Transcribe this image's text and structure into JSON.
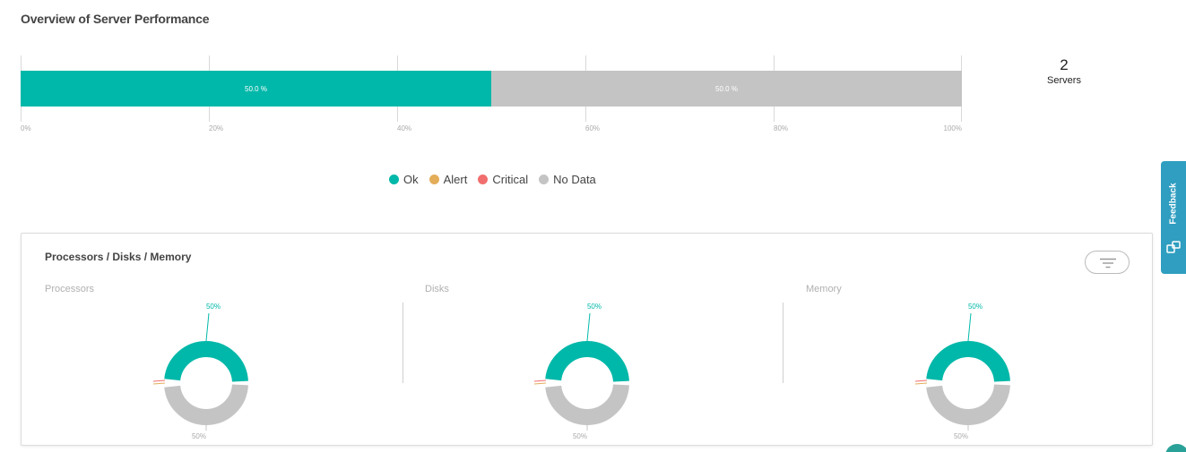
{
  "page": {
    "title": "Overview of Server Performance"
  },
  "colors": {
    "ok": "#00b8a9",
    "alert": "#e4ad5a",
    "critical": "#f16e6e",
    "no_data": "#c4c4c4",
    "feedback": "#2f9ec0"
  },
  "overview": {
    "ticks": [
      "0%",
      "20%",
      "40%",
      "60%",
      "80%",
      "100%"
    ],
    "segments": [
      {
        "status": "ok",
        "value": 50.0,
        "label": "50.0 %"
      },
      {
        "status": "no_data",
        "value": 50.0,
        "label": "50.0 %"
      }
    ],
    "server_count": "2",
    "server_label": "Servers"
  },
  "legend": [
    {
      "label": "Ok",
      "color": "#00b8a9"
    },
    {
      "label": "Alert",
      "color": "#e4ad5a"
    },
    {
      "label": "Critical",
      "color": "#f16e6e"
    },
    {
      "label": "No Data",
      "color": "#c4c4c4"
    }
  ],
  "card": {
    "title": "Processors / Disks / Memory",
    "filter_icon": "filter-icon",
    "panels": [
      {
        "label": "Processors",
        "ok_percent": 50,
        "no_data_percent": 50,
        "top_label": "50%",
        "bottom_label": "50%"
      },
      {
        "label": "Disks",
        "ok_percent": 50,
        "no_data_percent": 50,
        "top_label": "50%",
        "bottom_label": "50%"
      },
      {
        "label": "Memory",
        "ok_percent": 50,
        "no_data_percent": 50,
        "top_label": "50%",
        "bottom_label": "50%"
      }
    ]
  },
  "feedback": {
    "label": "Feedback",
    "icon": "feedback-icon"
  }
}
